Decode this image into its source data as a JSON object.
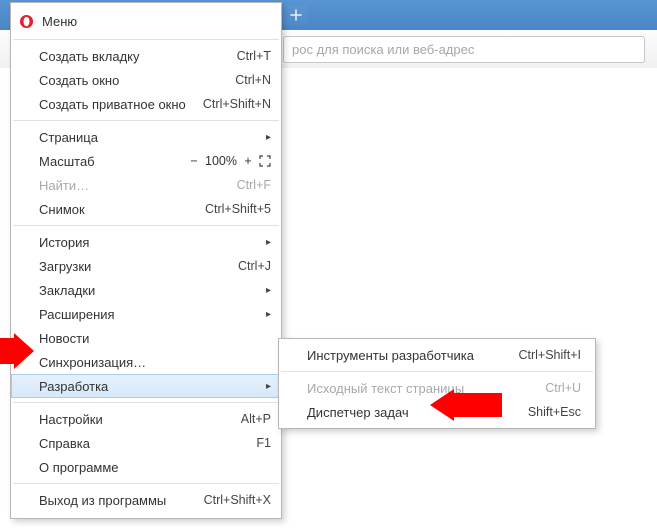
{
  "browser": {
    "search_placeholder": "рос для поиска или веб-адрес"
  },
  "menu": {
    "title": "Меню",
    "items": {
      "new_tab": {
        "label": "Создать вкладку",
        "shortcut": "Ctrl+T"
      },
      "new_window": {
        "label": "Создать окно",
        "shortcut": "Ctrl+N"
      },
      "new_private": {
        "label": "Создать приватное окно",
        "shortcut": "Ctrl+Shift+N"
      },
      "page": {
        "label": "Страница"
      },
      "zoom": {
        "label": "Масштаб",
        "minus": "−",
        "value": "100%",
        "plus": "+"
      },
      "find": {
        "label": "Найти…",
        "shortcut": "Ctrl+F"
      },
      "snapshot": {
        "label": "Снимок",
        "shortcut": "Ctrl+Shift+5"
      },
      "history": {
        "label": "История"
      },
      "downloads": {
        "label": "Загрузки",
        "shortcut": "Ctrl+J"
      },
      "bookmarks": {
        "label": "Закладки"
      },
      "extensions": {
        "label": "Расширения"
      },
      "news": {
        "label": "Новости"
      },
      "sync": {
        "label": "Синхронизация…"
      },
      "developer": {
        "label": "Разработка"
      },
      "settings": {
        "label": "Настройки",
        "shortcut": "Alt+P"
      },
      "help": {
        "label": "Справка",
        "shortcut": "F1"
      },
      "about": {
        "label": "О программе"
      },
      "exit": {
        "label": "Выход из программы",
        "shortcut": "Ctrl+Shift+X"
      }
    }
  },
  "submenu": {
    "devtools": {
      "label": "Инструменты разработчика",
      "shortcut": "Ctrl+Shift+I"
    },
    "view_source": {
      "label": "Исходный текст страницы",
      "shortcut": "Ctrl+U"
    },
    "task_mgr": {
      "label": "Диспетчер задач",
      "shortcut": "Shift+Esc"
    }
  }
}
